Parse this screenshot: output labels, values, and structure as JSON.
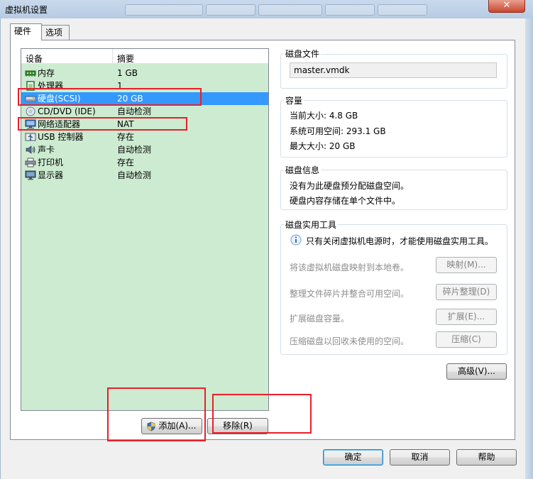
{
  "window": {
    "title": "虚拟机设置",
    "close_glyph": "✕"
  },
  "tabs": [
    {
      "label": "硬件"
    },
    {
      "label": "选项"
    }
  ],
  "device_list": {
    "headers": {
      "device": "设备",
      "summary": "摘要"
    },
    "rows": [
      {
        "name": "内存",
        "summary": "1 GB",
        "icon": "memory-icon"
      },
      {
        "name": "处理器",
        "summary": "1",
        "icon": "processor-icon"
      },
      {
        "name": "硬盘(SCSI)",
        "summary": "20 GB",
        "icon": "hard-disk-icon",
        "selected": true
      },
      {
        "name": "CD/DVD (IDE)",
        "summary": "自动检测",
        "icon": "cd-dvd-icon"
      },
      {
        "name": "网络适配器",
        "summary": "NAT",
        "icon": "network-adapter-icon"
      },
      {
        "name": "USB 控制器",
        "summary": "存在",
        "icon": "usb-icon"
      },
      {
        "name": "声卡",
        "summary": "自动检测",
        "icon": "sound-card-icon"
      },
      {
        "name": "打印机",
        "summary": "存在",
        "icon": "printer-icon"
      },
      {
        "name": "显示器",
        "summary": "自动检测",
        "icon": "display-icon"
      }
    ],
    "add_button": "添加(A)...",
    "remove_button": "移除(R)"
  },
  "disk_file": {
    "label": "磁盘文件",
    "value": "master.vmdk"
  },
  "capacity": {
    "label": "容量",
    "current_size": "当前大小: 4.8 GB",
    "system_free": "系统可用空间: 293.1 GB",
    "max_size": "最大大小: 20 GB"
  },
  "disk_info": {
    "label": "磁盘信息",
    "line1": "没有为此硬盘预分配磁盘空间。",
    "line2": "硬盘内容存储在单个文件中。"
  },
  "disk_utilities": {
    "label": "磁盘实用工具",
    "note": "只有关闭虚拟机电源时，才能使用磁盘实用工具。",
    "items": [
      {
        "desc": "将该虚拟机磁盘映射到本地卷。",
        "button": "映射(M)..."
      },
      {
        "desc": "整理文件碎片并整合可用空间。",
        "button": "碎片整理(D)"
      },
      {
        "desc": "扩展磁盘容量。",
        "button": "扩展(E)..."
      },
      {
        "desc": "压缩磁盘以回收未使用的空间。",
        "button": "压缩(C)"
      }
    ]
  },
  "advanced_button": "高级(V)...",
  "footer": {
    "ok": "确定",
    "cancel": "取消",
    "help": "帮助"
  }
}
